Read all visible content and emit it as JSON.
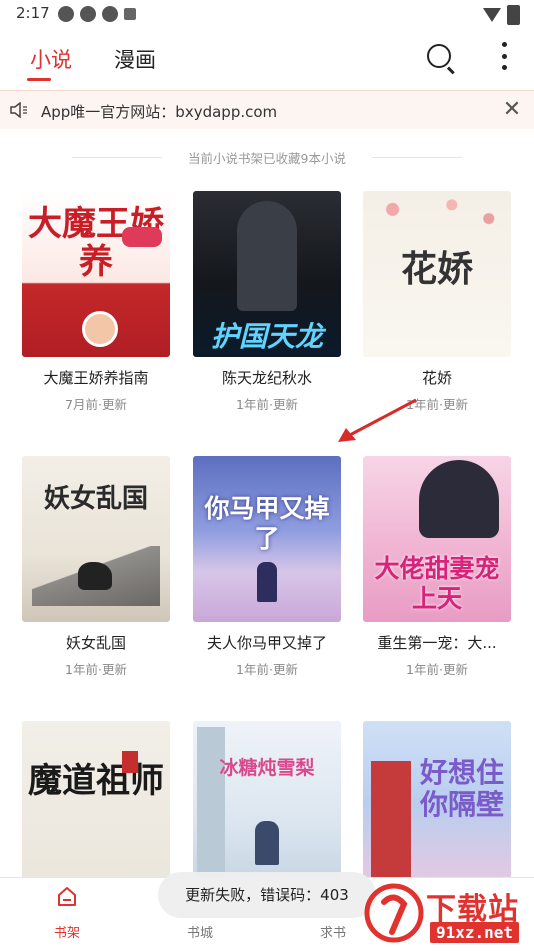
{
  "status_bar": {
    "time": "2:17"
  },
  "top_nav": {
    "tabs": [
      {
        "label": "小说",
        "active": true
      },
      {
        "label": "漫画",
        "active": false
      }
    ]
  },
  "notice": {
    "text": "App唯一官方网站：bxydapp.com",
    "close_symbol": "✕"
  },
  "shelf_info": "当前小说书架已收藏9本小说",
  "books": [
    {
      "title": "大魔王娇养指南",
      "updated": "7月前·更新",
      "cover_text": "大魔王娇养"
    },
    {
      "title": "陈天龙纪秋水",
      "updated": "1年前·更新",
      "cover_text": "护国天龙"
    },
    {
      "title": "花娇",
      "updated": "1年前·更新",
      "cover_text": "花娇"
    },
    {
      "title": "妖女乱国",
      "updated": "1年前·更新",
      "cover_text": "妖女乱国"
    },
    {
      "title": "夫人你马甲又掉了",
      "updated": "1年前·更新",
      "cover_text": "你马甲又掉了"
    },
    {
      "title": "重生第一宠：大...",
      "updated": "1年前·更新",
      "cover_text": "大佬甜妻宠上天"
    },
    {
      "title": "",
      "updated": "",
      "cover_text": "魔道祖师"
    },
    {
      "title": "",
      "updated": "",
      "cover_text": "冰糖炖雪梨"
    },
    {
      "title": "",
      "updated": "",
      "cover_text": "好想住你隔壁"
    }
  ],
  "bottom_nav": [
    {
      "label": "书架",
      "active": true
    },
    {
      "label": "书城",
      "active": false
    },
    {
      "label": "求书",
      "active": false
    }
  ],
  "toast": "更新失败，错误码：403",
  "watermark": {
    "text": "下载站",
    "url": "91xz.net"
  },
  "colors": {
    "accent": "#e0322e",
    "notice_bg": "#fdf5f1",
    "muted": "#8a8a8a"
  }
}
